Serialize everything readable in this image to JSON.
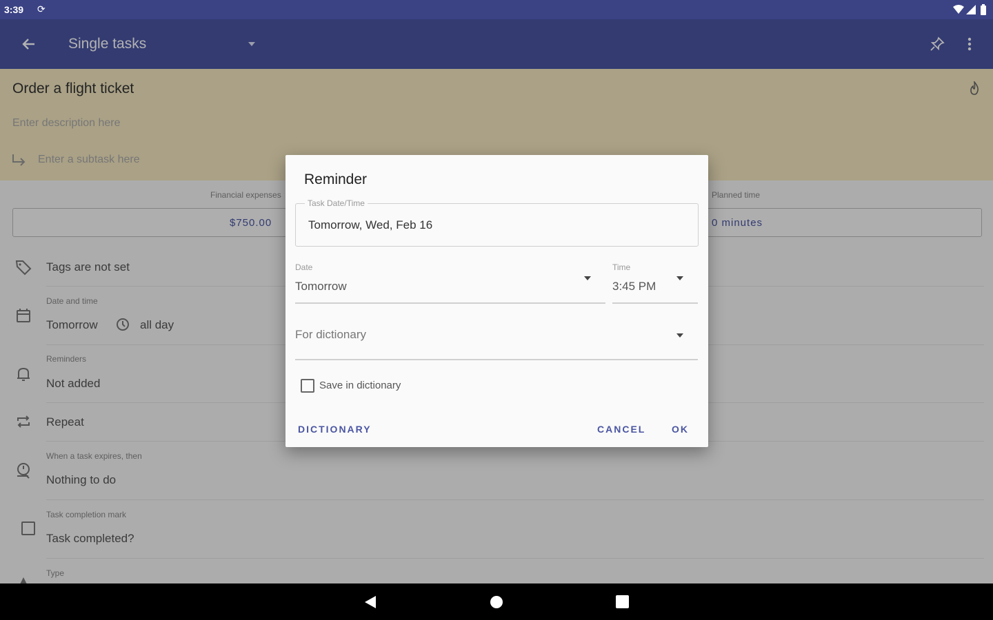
{
  "status_bar": {
    "time": "3:39"
  },
  "app_bar": {
    "title": "Single tasks"
  },
  "task": {
    "title": "Order a flight ticket",
    "description_placeholder": "Enter description here",
    "subtask_placeholder": "Enter a subtask here"
  },
  "fields": {
    "financial_label": "Financial expenses",
    "financial_value": "$750.00",
    "planned_label": "Planned time",
    "planned_value": "0 minutes",
    "tags_value": "Tags are not set",
    "datetime_label": "Date and time",
    "datetime_date": "Tomorrow",
    "datetime_time": "all day",
    "reminders_label": "Reminders",
    "reminders_value": "Not added",
    "repeat_value": "Repeat",
    "expire_label": "When a task expires, then",
    "expire_value": "Nothing to do",
    "completion_label": "Task completion mark",
    "completion_value": "Task completed?",
    "type_label": "Type"
  },
  "dialog": {
    "title": "Reminder",
    "task_datetime_label": "Task Date/Time",
    "task_datetime_value": "Tomorrow, Wed, Feb 16",
    "date_label": "Date",
    "date_value": "Tomorrow",
    "time_label": "Time",
    "time_value": "3:45 PM",
    "dictionary_select": "For dictionary",
    "save_checkbox_label": "Save in dictionary",
    "btn_dictionary": "DICTIONARY",
    "btn_cancel": "CANCEL",
    "btn_ok": "OK"
  },
  "colors": {
    "status_bar": "#3b4385",
    "app_bar": "#4a55a2",
    "task_header": "#f4e7c0",
    "accent": "#4a55a2"
  }
}
